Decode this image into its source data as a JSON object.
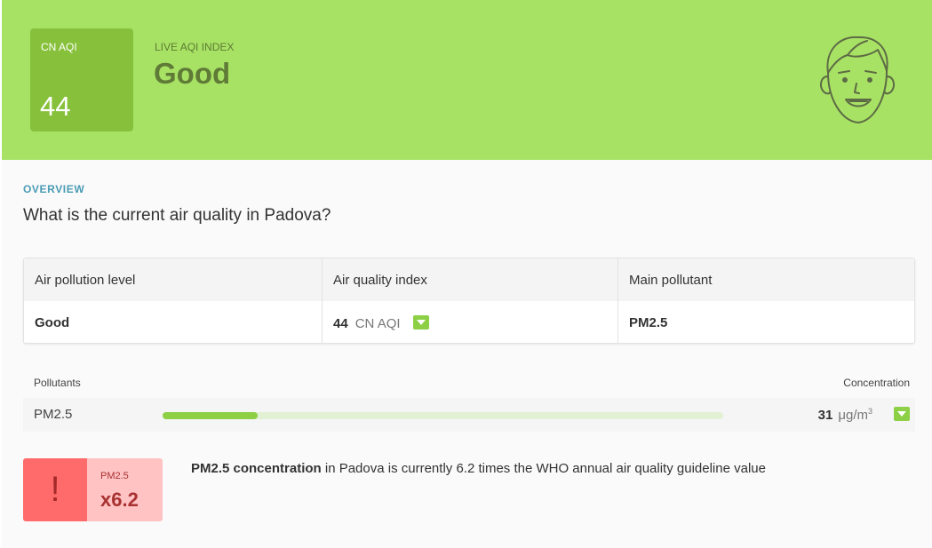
{
  "header": {
    "aqi_label": "CN AQI",
    "aqi_value": "44",
    "live_label": "LIVE AQI INDEX",
    "status": "Good",
    "face_icon": "smiling-face-icon",
    "colors": {
      "banner": "#a8e265",
      "aqi_box": "#87c13b",
      "status_text": "#5f7b37"
    }
  },
  "overview": {
    "section_label": "OVERVIEW",
    "question": "What is the current air quality in Padova?"
  },
  "summary_table": {
    "headers": [
      "Air pollution level",
      "Air quality index",
      "Main pollutant"
    ],
    "level": "Good",
    "aqi_value": "44",
    "aqi_unit": "CN AQI",
    "main_pollutant": "PM2.5"
  },
  "pollutants": {
    "header_left": "Pollutants",
    "header_right": "Concentration",
    "rows": [
      {
        "name": "PM2.5",
        "value": "31",
        "unit": "μg/m",
        "unit_sup": "3",
        "bar_level": 0.17
      }
    ]
  },
  "alert": {
    "icon": "!",
    "pollutant": "PM2.5",
    "multiplier": "x6.2",
    "text_bold": "PM2.5 concentration",
    "text_rest": " in Padova is currently 6.2 times the WHO annual air quality guideline value",
    "colors": {
      "left": "#ff6b6b",
      "right": "#ffc3c3"
    }
  }
}
